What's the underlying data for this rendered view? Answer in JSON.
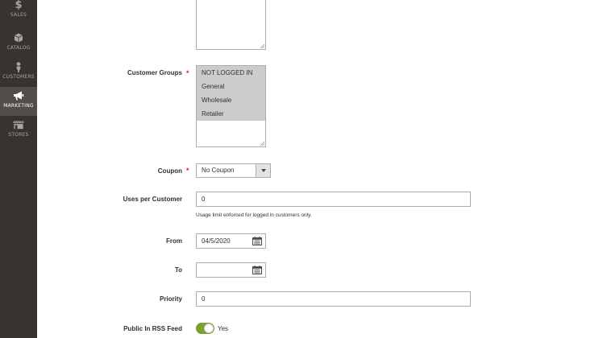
{
  "sidebar": {
    "items": [
      {
        "label": "SALES",
        "icon": "dollar-icon",
        "glyph": "$"
      },
      {
        "label": "CATALOG",
        "icon": "box-icon"
      },
      {
        "label": "CUSTOMERS",
        "icon": "person-icon"
      },
      {
        "label": "MARKETING",
        "icon": "megaphone-icon",
        "active": true
      },
      {
        "label": "STORES",
        "icon": "storefront-icon"
      }
    ]
  },
  "form": {
    "customer_groups": {
      "label": "Customer Groups",
      "required": "*",
      "options": [
        "NOT LOGGED IN",
        "General",
        "Wholesale",
        "Retailer"
      ],
      "selected": [
        "NOT LOGGED IN",
        "General",
        "Wholesale",
        "Retailer"
      ]
    },
    "coupon": {
      "label": "Coupon",
      "required": "*",
      "value": "No Coupon"
    },
    "uses_per_customer": {
      "label": "Uses per Customer",
      "value": "0",
      "note": "Usage limit enforced for logged in customers only."
    },
    "from": {
      "label": "From",
      "value": "04/5/2020"
    },
    "to": {
      "label": "To",
      "value": ""
    },
    "priority": {
      "label": "Priority",
      "value": "0"
    },
    "rss_feed": {
      "label": "Public In RSS Feed",
      "state_text": "Yes",
      "checked": true
    }
  },
  "colors": {
    "sidebar_bg": "#373330",
    "sidebar_active": "#524d49",
    "required": "#e22626",
    "toggle_on": "#79a22e",
    "selected_option": "#cccccc"
  }
}
